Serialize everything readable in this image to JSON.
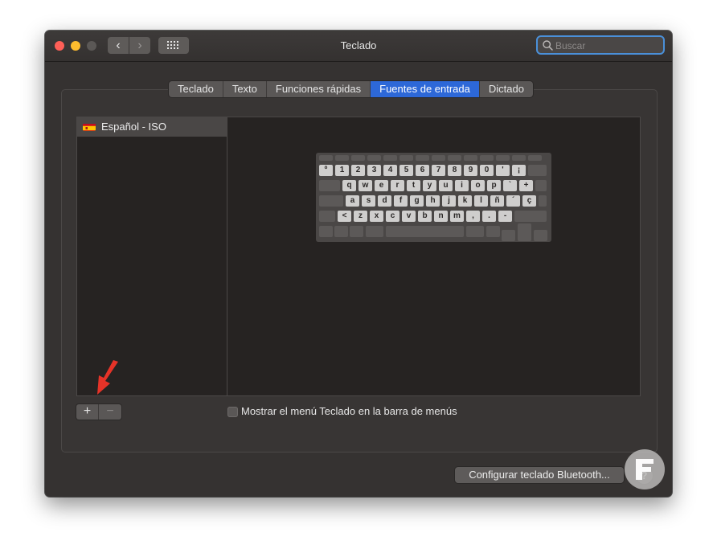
{
  "window": {
    "title": "Teclado"
  },
  "toolbar": {
    "back_icon": "chevron-left-icon",
    "forward_icon": "chevron-right-icon",
    "grid_icon": "grid-icon",
    "back_glyph": "‹",
    "forward_glyph": "›"
  },
  "search": {
    "placeholder": "Buscar",
    "value": ""
  },
  "tabs": [
    {
      "label": "Teclado",
      "active": false
    },
    {
      "label": "Texto",
      "active": false
    },
    {
      "label": "Funciones rápidas",
      "active": false
    },
    {
      "label": "Fuentes de entrada",
      "active": true
    },
    {
      "label": "Dictado",
      "active": false
    }
  ],
  "input_sources": [
    {
      "label": "Español - ISO",
      "flag": "spain-flag-icon",
      "selected": true
    }
  ],
  "keyboard_layout": {
    "row1": [
      "º",
      "1",
      "2",
      "3",
      "4",
      "5",
      "6",
      "7",
      "8",
      "9",
      "0",
      "'",
      "¡"
    ],
    "row2": [
      "q",
      "w",
      "e",
      "r",
      "t",
      "y",
      "u",
      "i",
      "o",
      "p",
      "`",
      "+"
    ],
    "row3": [
      "a",
      "s",
      "d",
      "f",
      "g",
      "h",
      "j",
      "k",
      "l",
      "ñ",
      "´",
      "ç"
    ],
    "row4": [
      "<",
      "z",
      "x",
      "c",
      "v",
      "b",
      "n",
      "m",
      ",",
      ".",
      "-"
    ]
  },
  "list_controls": {
    "add_label": "+",
    "remove_label": "−"
  },
  "options": {
    "show_menu_label": "Mostrar el menú Teclado en la barra de menús",
    "show_menu_checked": false
  },
  "buttons": {
    "bluetooth_label": "Configurar teclado Bluetooth...",
    "help_label": "?"
  },
  "colors": {
    "accent": "#2d68d8",
    "close": "#fe5f57",
    "minimize": "#febc2e",
    "annotation_arrow": "#e53328"
  }
}
